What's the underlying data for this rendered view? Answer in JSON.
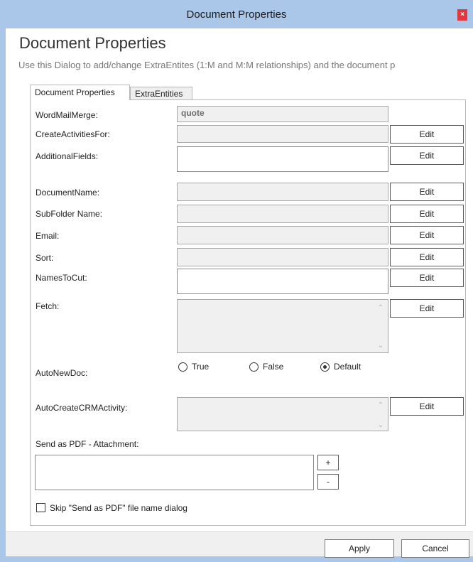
{
  "window": {
    "title": "Document Properties",
    "close_label": "×"
  },
  "header": {
    "title": "Document Properties",
    "subtitle": "Use this Dialog to add/change ExtraEntites (1:M and M:M relationships) and the document p"
  },
  "tabs": [
    {
      "label": "Document Properties",
      "active": true
    },
    {
      "label": "ExtraEntities",
      "active": false
    }
  ],
  "fields": {
    "word_mail_merge": {
      "label": "WordMailMerge:",
      "value": "quote"
    },
    "create_activities_for": {
      "label": "CreateActivitiesFor:",
      "value": "",
      "button": "Edit"
    },
    "additional_fields": {
      "label": "AdditionalFields:",
      "value": "",
      "button": "Edit"
    },
    "document_name": {
      "label": "DocumentName:",
      "value": "",
      "button": "Edit"
    },
    "subfolder_name": {
      "label": "SubFolder Name:",
      "value": "",
      "button": "Edit"
    },
    "email": {
      "label": "Email:",
      "value": "",
      "button": "Edit"
    },
    "sort": {
      "label": "Sort:",
      "value": "",
      "button": "Edit"
    },
    "names_to_cut": {
      "label": "NamesToCut:",
      "value": "",
      "button": "Edit"
    },
    "fetch": {
      "label": "Fetch:",
      "value": "",
      "button": "Edit"
    },
    "auto_new_doc": {
      "label": "AutoNewDoc:",
      "options": [
        "True",
        "False",
        "Default"
      ],
      "selected": "Default"
    },
    "auto_create_crm_activity": {
      "label": "AutoCreateCRMActivity:",
      "value": "",
      "button": "Edit"
    }
  },
  "pdf": {
    "label": "Send as PDF - Attachment:",
    "add_label": "+",
    "remove_label": "-",
    "skip_label": "Skip \"Send as PDF\" file name dialog",
    "skip_checked": false
  },
  "scroll_icons": {
    "up": "chevron-up-icon",
    "down": "chevron-down-icon"
  },
  "footer": {
    "apply_label": "Apply",
    "cancel_label": "Cancel"
  },
  "colors": {
    "titlebar": "#aac7ea",
    "close": "#e0383e",
    "footer": "#f0f0f0"
  }
}
